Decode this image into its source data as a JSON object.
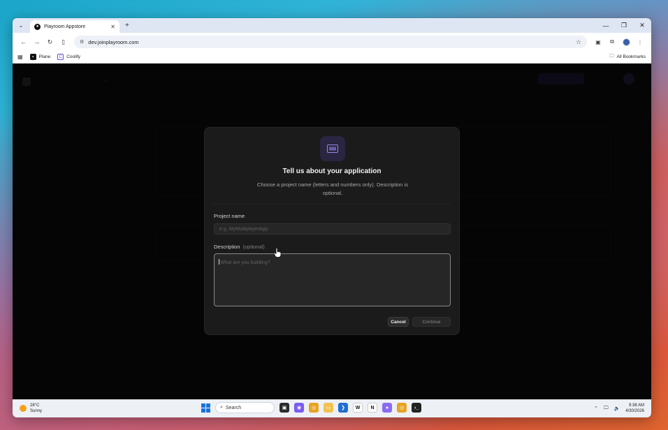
{
  "browser": {
    "tab_title": "Playroom Appstore",
    "url": "dev.joinplayroom.com",
    "bookmarks": [
      {
        "label": "Plane"
      },
      {
        "label": "Coolify"
      }
    ],
    "all_bookmarks_label": "All Bookmarks"
  },
  "modal": {
    "title": "Tell us about your application",
    "description": "Choose a project name (letters and numbers only). Description is optional.",
    "project_name_label": "Project name",
    "project_name_placeholder": "e.g. MyMultiplayerApp",
    "description_label": "Description",
    "description_optional": "(optional)",
    "description_placeholder": "What are you building?",
    "cancel_label": "Cancel",
    "continue_label": "Continue"
  },
  "taskbar": {
    "weather_temp": "28°C",
    "weather_desc": "Sunny",
    "search_label": "Search",
    "time": "9:38 AM",
    "date": "4/30/2026"
  },
  "colors": {
    "accent": "#2a2540",
    "modal_bg": "#1b1b1b",
    "page_bg": "#0d0d0d"
  }
}
